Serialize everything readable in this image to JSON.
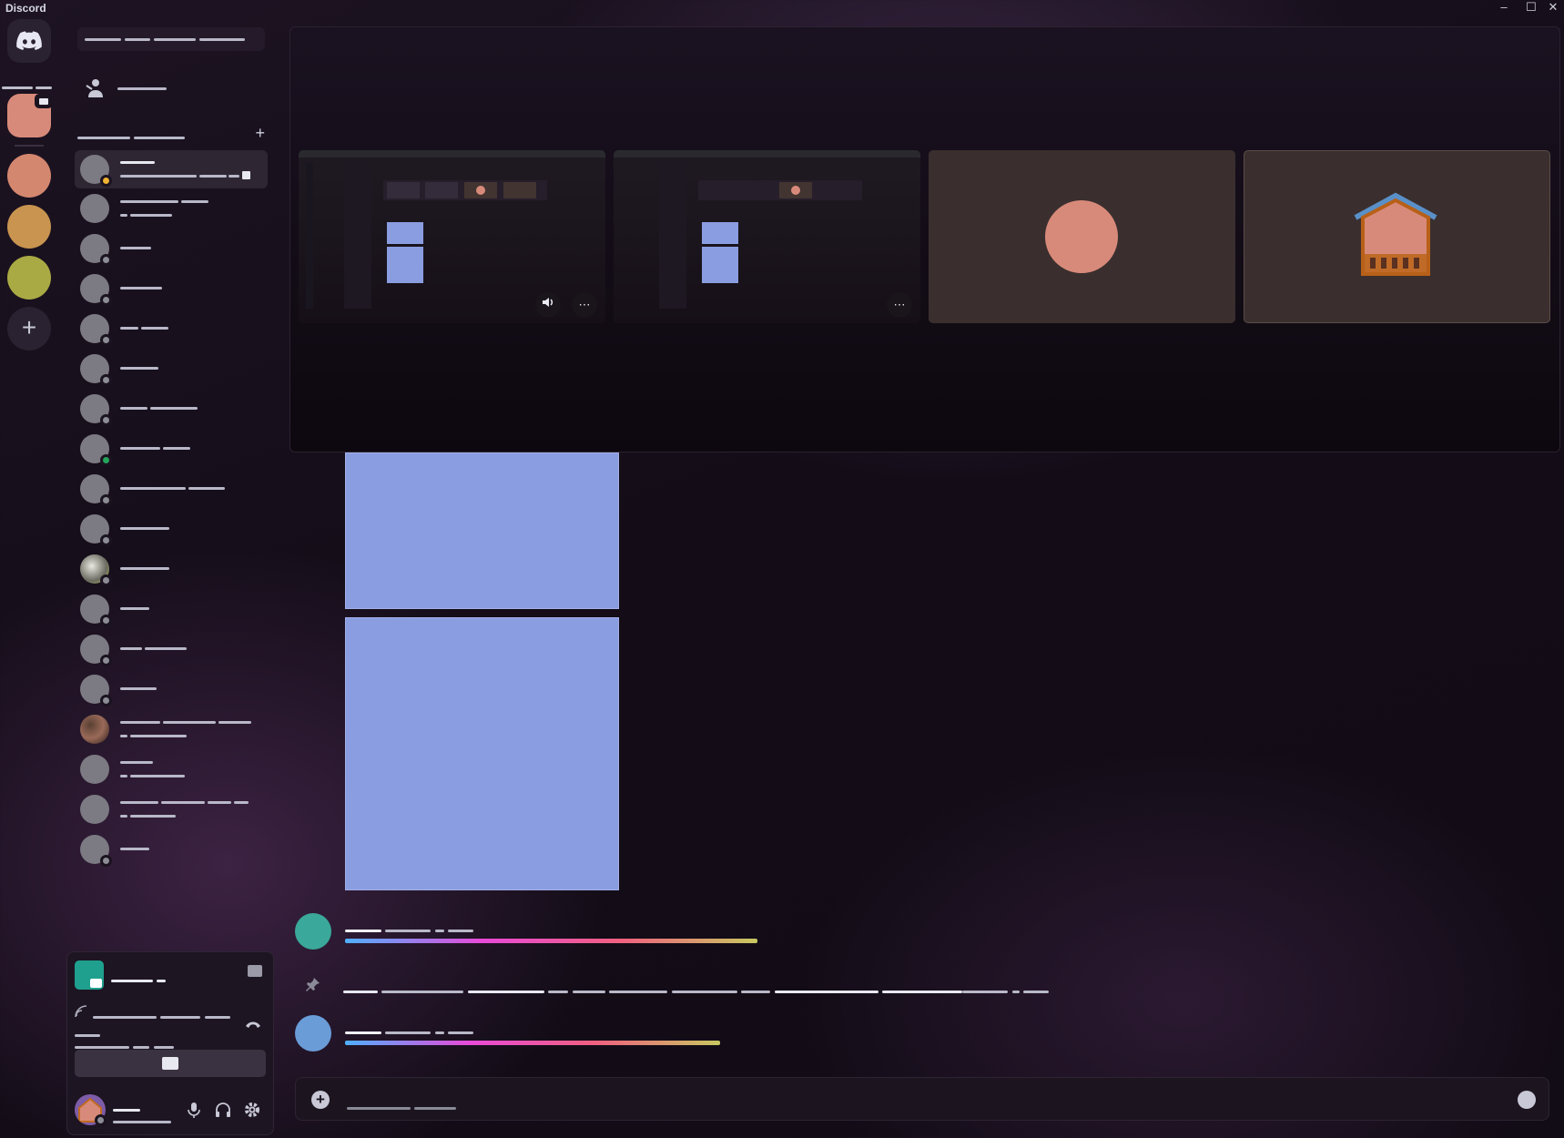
{
  "app": {
    "title": "Discord"
  },
  "window": {
    "minimize": "–",
    "maximize": "☐",
    "close": "✕"
  },
  "servers": {
    "add_label": "+",
    "items": [
      {
        "color": "#d88a7a"
      },
      {
        "color": "#d4876f"
      },
      {
        "color": "#c8944f"
      },
      {
        "color": "#a9aa44"
      }
    ]
  },
  "dm_list": {
    "add_dm_label": "+"
  },
  "call_tiles": {
    "volume_icon": "speaker-icon",
    "more_label": "⋯",
    "avatar_color": "#d88a7a"
  },
  "composer": {
    "add_label": "+"
  },
  "colors": {
    "accent_image": "#8a9de0",
    "online": "#23a55a",
    "idle": "#f0b232",
    "screen_share": "#1fa08e",
    "message_avatar_1": "#3aa89a",
    "message_avatar_2": "#6a9cd8"
  }
}
